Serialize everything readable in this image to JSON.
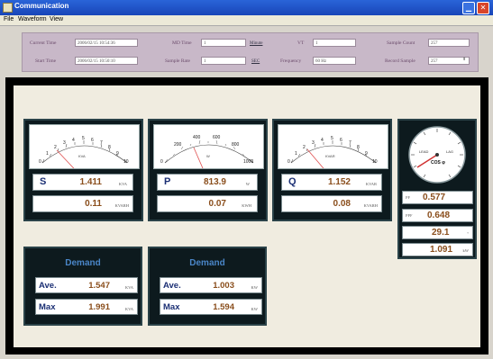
{
  "window": {
    "title": "Communication"
  },
  "menu": [
    "File",
    "Waveform",
    "View"
  ],
  "info": {
    "current_time_label": "Current Time",
    "current_time": "2006/02/15 10:54:36",
    "start_time_label": "Start Time",
    "start_time": "2006/02/15 10:50:10",
    "md_time_label": "MD Time",
    "md_time": "1",
    "md_time_unit": "Minute",
    "sample_rate_label": "Sample Rate",
    "sample_rate": "1",
    "sample_rate_unit": "SEC",
    "vt_label": "VT",
    "vt": "1",
    "frequency_label": "Frequency",
    "frequency": "60 Hz",
    "sample_count_label": "Sample Count",
    "sample_count": "257",
    "record_sample_label": "Record Sample",
    "record_sample": "257"
  },
  "meters": [
    {
      "symbol": "S",
      "value": "1.411",
      "unit": "KVA",
      "sub_value": "0.11",
      "sub_unit": "KVARH",
      "dial_unit": "KVA",
      "ticks": [
        "0",
        "1",
        "2",
        "3",
        "4",
        "5",
        "6",
        "7",
        "8",
        "9",
        "10"
      ]
    },
    {
      "symbol": "P",
      "value": "813.9",
      "unit": "W",
      "sub_value": "0.07",
      "sub_unit": "KWH",
      "dial_unit": "W",
      "ticks": [
        "0",
        "200",
        "400",
        "600",
        "800",
        "1000"
      ]
    },
    {
      "symbol": "Q",
      "value": "1.152",
      "unit": "KVAR",
      "sub_value": "0.08",
      "sub_unit": "KVARH",
      "dial_unit": "KVAR",
      "ticks": [
        "0",
        "1",
        "2",
        "3",
        "4",
        "5",
        "6",
        "7",
        "8",
        "9",
        "10"
      ]
    }
  ],
  "demand": [
    {
      "title": "Demand",
      "ave_label": "Ave.",
      "ave_value": "1.547",
      "ave_unit": "KVA",
      "max_label": "Max",
      "max_value": "1.991",
      "max_unit": "KVA"
    },
    {
      "title": "Demand",
      "ave_label": "Ave.",
      "ave_value": "1.003",
      "ave_unit": "KW",
      "max_label": "Max",
      "max_value": "1.594",
      "max_unit": "KW"
    }
  ],
  "pf": {
    "gauge_lead": "LEAD",
    "gauge_lag": "LAG",
    "gauge_label": "COS φ",
    "pf_label": "PF",
    "pf_value": "0.577",
    "ppf_label": "PPF",
    "ppf_value": "0.648",
    "angle_value": "29.1",
    "angle_unit": "°",
    "hz_value": "1.091",
    "hz_unit": "kW"
  }
}
